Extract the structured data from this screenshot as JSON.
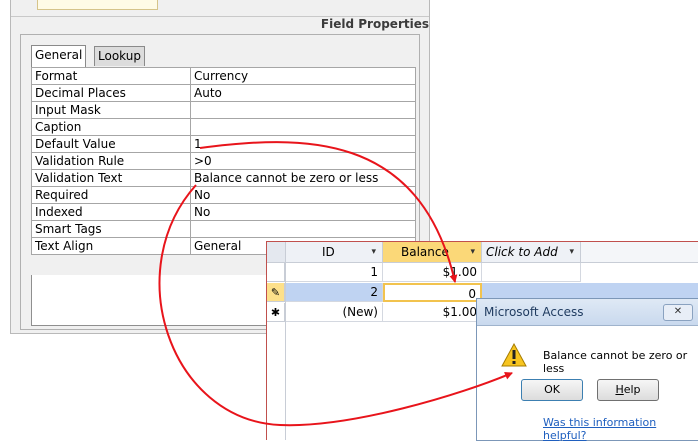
{
  "panel": {
    "title": "Field Properties"
  },
  "tabs": [
    "General",
    "Lookup"
  ],
  "properties": [
    {
      "name": "Format",
      "value": "Currency"
    },
    {
      "name": "Decimal Places",
      "value": "Auto"
    },
    {
      "name": "Input Mask",
      "value": ""
    },
    {
      "name": "Caption",
      "value": ""
    },
    {
      "name": "Default Value",
      "value": "1"
    },
    {
      "name": "Validation Rule",
      "value": ">0"
    },
    {
      "name": "Validation Text",
      "value": "Balance cannot be zero or less"
    },
    {
      "name": "Required",
      "value": "No"
    },
    {
      "name": "Indexed",
      "value": "No"
    },
    {
      "name": "Smart Tags",
      "value": ""
    },
    {
      "name": "Text Align",
      "value": "General"
    }
  ],
  "datasheet": {
    "columns": [
      "ID",
      "Balance",
      "Click to Add"
    ],
    "rows": [
      {
        "selector": "",
        "id": "1",
        "balance": "$1.00"
      },
      {
        "selector": "pencil-icon",
        "id": "2",
        "balance": "0"
      },
      {
        "selector": "new-record-icon",
        "id": "(New)",
        "balance": "$1.00"
      }
    ]
  },
  "dialog": {
    "title": "Microsoft Access",
    "message": "Balance cannot be zero or less",
    "ok": "OK",
    "help": "Help",
    "link": "Was this information helpful?",
    "icon": "warning-icon"
  },
  "colors": {
    "arrow": "#e8141b",
    "highlight": "#fde9a6",
    "row_selected": "#bfd3f2"
  }
}
